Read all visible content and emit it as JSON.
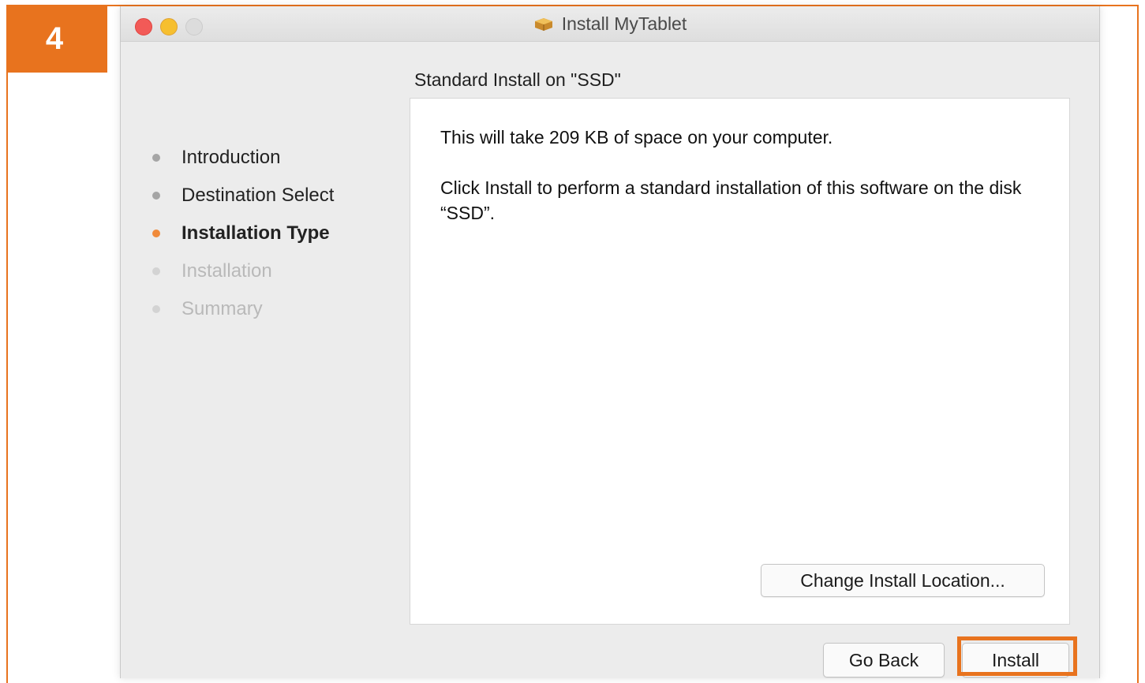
{
  "step_badge": {
    "number": "4"
  },
  "window": {
    "title": "Install MyTablet",
    "app_icon": "package-icon"
  },
  "pane_heading": "Standard Install on \"SSD\"",
  "sidebar": {
    "steps": [
      {
        "label": "Introduction",
        "state": "completed"
      },
      {
        "label": "Destination Select",
        "state": "completed"
      },
      {
        "label": "Installation Type",
        "state": "current"
      },
      {
        "label": "Installation",
        "state": "pending"
      },
      {
        "label": "Summary",
        "state": "pending"
      }
    ]
  },
  "content": {
    "space_text": "This will take 209 KB of space on your computer.",
    "instruction_text": "Click Install to perform a standard installation of this software on the disk “SSD”."
  },
  "buttons": {
    "change_location": "Change Install Location...",
    "go_back": "Go Back",
    "install": "Install"
  },
  "colors": {
    "highlight": "#e8731e",
    "current_step_dot": "#f08a3a",
    "close": "#f25a57",
    "minimize": "#f6bf2f"
  }
}
